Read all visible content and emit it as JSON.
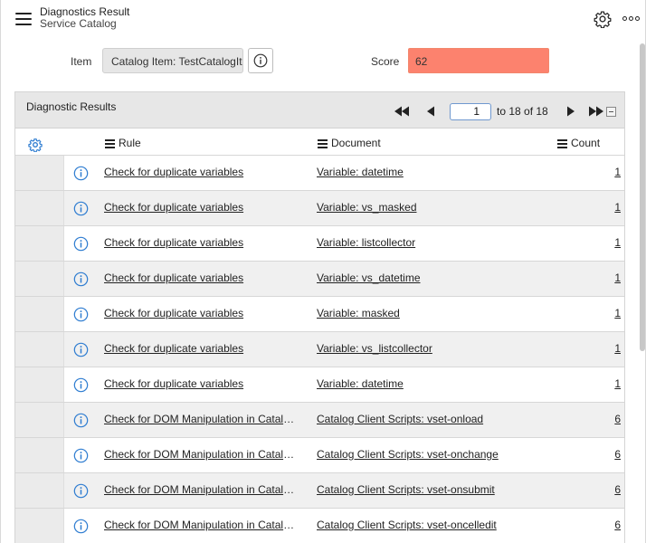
{
  "header": {
    "title": "Diagnostics Result",
    "subtitle": "Service Catalog"
  },
  "form": {
    "item_label": "Item",
    "item_value": "Catalog Item: TestCatalogIte",
    "score_label": "Score",
    "score_value": "62"
  },
  "colors": {
    "score_bg": "#fc826e",
    "accent_blue": "#2f7dd1"
  },
  "results": {
    "title": "Diagnostic Results",
    "page": "1",
    "page_of": "to 18 of 18",
    "columns": {
      "rule": "Rule",
      "document": "Document",
      "count": "Count"
    },
    "rows": [
      {
        "rule": "Check for duplicate variables",
        "document": "Variable: datetime",
        "count": "1"
      },
      {
        "rule": "Check for duplicate variables",
        "document": "Variable: vs_masked",
        "count": "1"
      },
      {
        "rule": "Check for duplicate variables",
        "document": "Variable: listcollector",
        "count": "1"
      },
      {
        "rule": "Check for duplicate variables",
        "document": "Variable: vs_datetime",
        "count": "1"
      },
      {
        "rule": "Check for duplicate variables",
        "document": "Variable: masked",
        "count": "1"
      },
      {
        "rule": "Check for duplicate variables",
        "document": "Variable: vs_listcollector",
        "count": "1"
      },
      {
        "rule": "Check for duplicate variables",
        "document": "Variable: datetime",
        "count": "1"
      },
      {
        "rule": "Check for DOM Manipulation in Catalog Cl...",
        "document": "Catalog Client Scripts: vset-onload",
        "count": "6"
      },
      {
        "rule": "Check for DOM Manipulation in Catalog Cl...",
        "document": "Catalog Client Scripts: vset-onchange",
        "count": "6"
      },
      {
        "rule": "Check for DOM Manipulation in Catalog Cl...",
        "document": "Catalog Client Scripts: vset-onsubmit",
        "count": "6"
      },
      {
        "rule": "Check for DOM Manipulation in Catalog Cl...",
        "document": "Catalog Client Scripts: vset-oncelledit",
        "count": "6"
      }
    ]
  },
  "icons": {
    "menu": "hamburger-icon",
    "settings": "gear-icon",
    "more": "more-horizontal-icon",
    "info": "info-icon",
    "first": "first-page-icon",
    "prev": "previous-page-icon",
    "next": "next-page-icon",
    "last": "last-page-icon",
    "column_menu": "column-menu-icon",
    "collapse": "collapse-icon"
  }
}
